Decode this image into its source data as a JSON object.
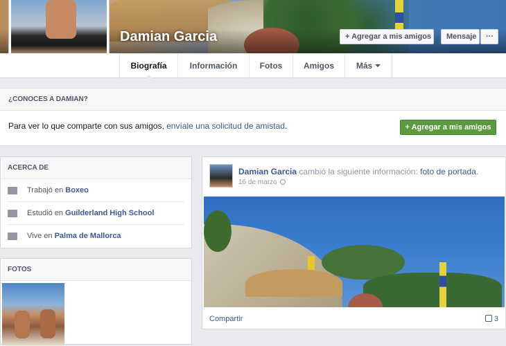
{
  "profile": {
    "name": "Damian Garcia",
    "add_friend": "Agregar a mis amigos",
    "message": "Mensaje",
    "more": "···"
  },
  "tabs": [
    {
      "label": "Biografía"
    },
    {
      "label": "Información"
    },
    {
      "label": "Fotos"
    },
    {
      "label": "Amigos"
    },
    {
      "label": "Más"
    }
  ],
  "know": {
    "title": "¿CONOCES A DAMIAN?",
    "text_before": "Para ver lo que comparte con sus amigos, ",
    "link": "envíale una solicitud de amistad",
    "text_after": ".",
    "button": "Agregar a mis amigos"
  },
  "about": {
    "title": "ACERCA DE",
    "items": [
      {
        "prefix": "Trabajó en ",
        "value": "Boxeo",
        "icon": "briefcase-icon"
      },
      {
        "prefix": "Estudió en ",
        "value": "Guilderland High School",
        "icon": "school-icon"
      },
      {
        "prefix": "Vive en ",
        "value": "Palma de Mallorca",
        "icon": "home-icon"
      }
    ]
  },
  "photos": {
    "title": "FOTOS"
  },
  "post": {
    "author": "Damian Garcia",
    "action": " cambió la siguiente información: ",
    "target": "foto de portada",
    "suffix": ".",
    "date": "16 de marzo",
    "share": "Compartir",
    "likes": "3"
  },
  "colors": {
    "link": "#3b5998",
    "green_button": "#5b9a3e",
    "background": "#e9eaed"
  }
}
